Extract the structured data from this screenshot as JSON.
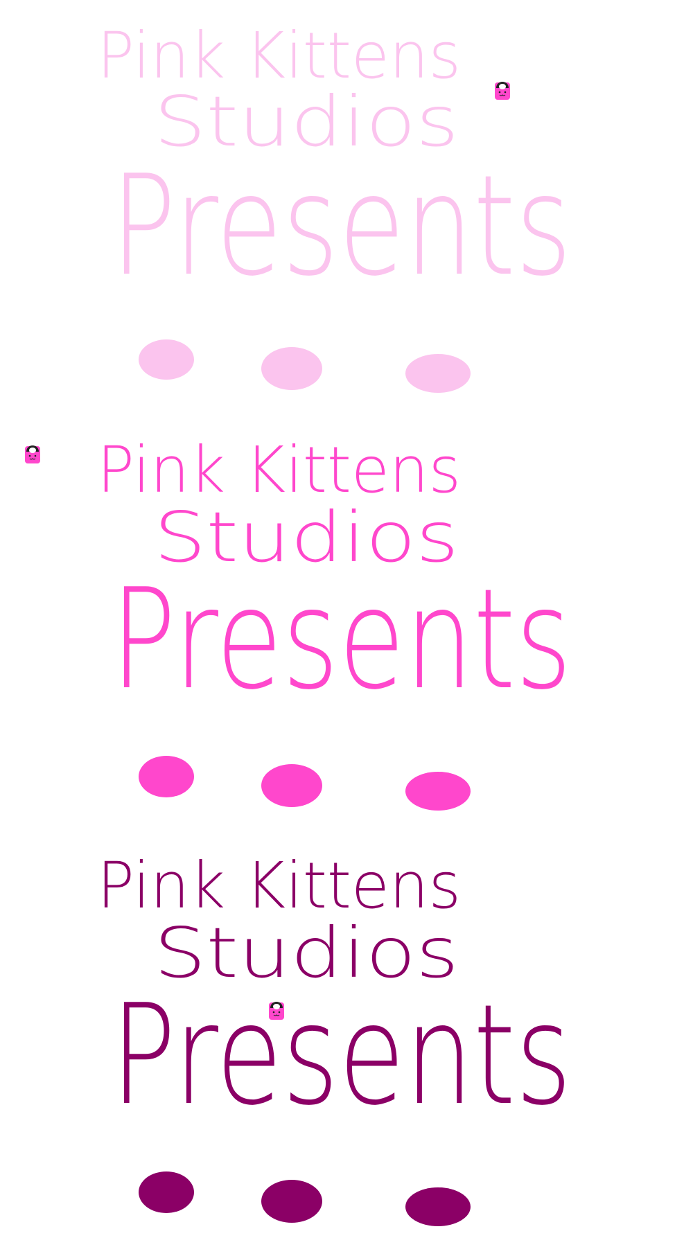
{
  "frames": [
    {
      "line1": "Pink Kittens",
      "line2": "Studios",
      "line3": "Presents",
      "color": "#fbc4ee"
    },
    {
      "line1": "Pink Kittens",
      "line2": "Studios",
      "line3": "Presents",
      "color": "#ff47cc"
    },
    {
      "line1": "Pink Kittens",
      "line2": "Studios",
      "line3": "Presents",
      "color": "#8b0066"
    }
  ],
  "kitty": {
    "body_color": "#ff47cc",
    "ear_color": "#222222",
    "icon": "kitty-icon"
  }
}
